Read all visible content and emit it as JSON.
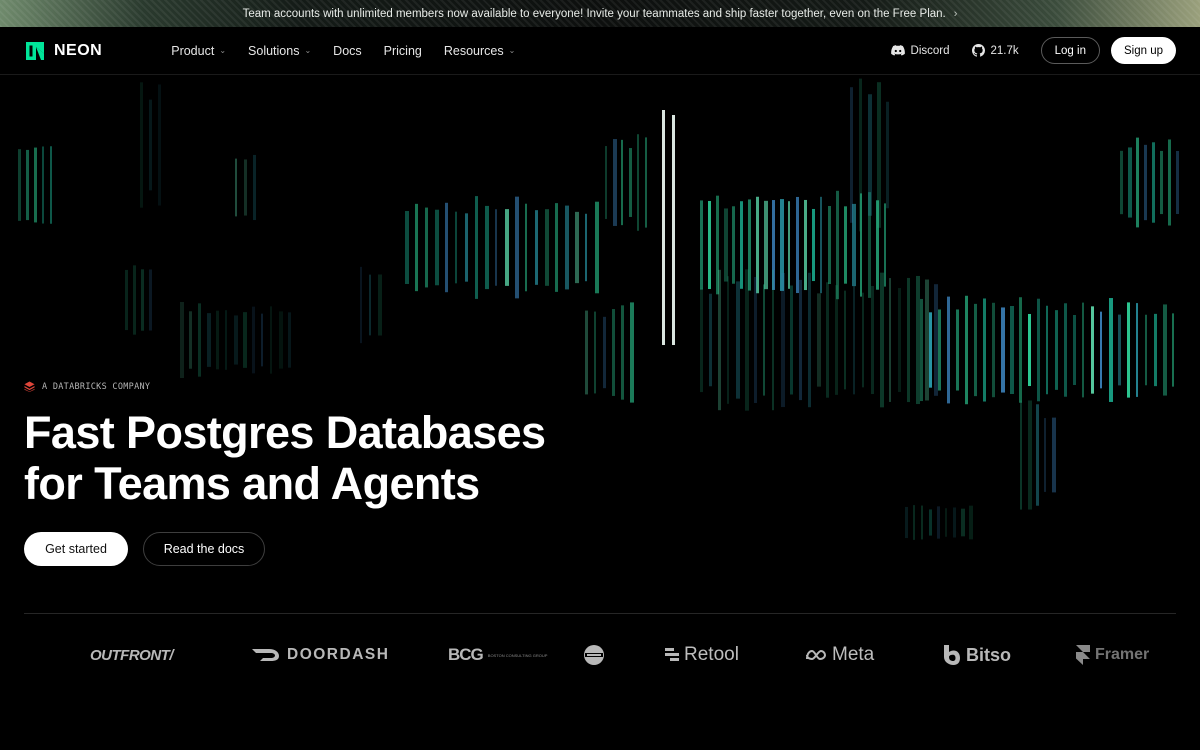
{
  "banner": {
    "text": "Team accounts with unlimited members now available to everyone! Invite your teammates and ship faster together, even on the Free Plan.",
    "chevron": "›"
  },
  "nav": {
    "logo": "NEON",
    "menu": [
      {
        "label": "Product",
        "dropdown": true
      },
      {
        "label": "Solutions",
        "dropdown": true
      },
      {
        "label": "Docs",
        "dropdown": false
      },
      {
        "label": "Pricing",
        "dropdown": false
      },
      {
        "label": "Resources",
        "dropdown": true
      }
    ],
    "discord": "Discord",
    "github_stars": "21.7k",
    "login": "Log in",
    "signup": "Sign up"
  },
  "hero": {
    "tagline": "A DATABRICKS COMPANY",
    "headline_line1": "Fast Postgres Databases",
    "headline_line2": "for Teams and Agents",
    "cta_primary": "Get started",
    "cta_secondary": "Read the docs"
  },
  "logos": [
    "OUTFRONT/",
    "DOORDASH",
    "BCG",
    "Retool",
    "Meta",
    "Bitso",
    "Framer"
  ],
  "bcg_subtext": "BOSTON CONSULTING GROUP",
  "colors": {
    "brand_green": "#00e599",
    "databricks_red": "#e0463a",
    "background": "#000000"
  },
  "icons": {
    "logo_mark": "neon-logo-icon",
    "discord": "discord-icon",
    "github": "github-icon",
    "databricks": "databricks-icon"
  }
}
